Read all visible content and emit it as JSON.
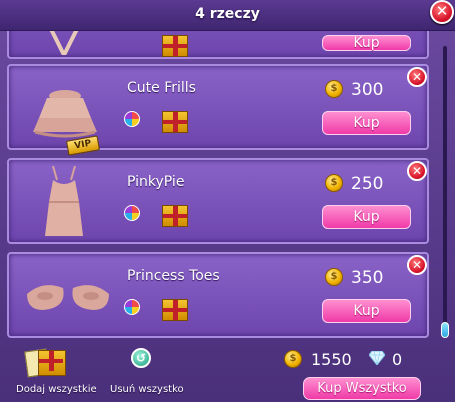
{
  "window": {
    "title": "4 rzeczy"
  },
  "items": [
    {
      "name": "Cute Frills",
      "price": "300",
      "buy_label": "Kup",
      "vip": "VIP"
    },
    {
      "name": "PinkyPie",
      "price": "250",
      "buy_label": "Kup"
    },
    {
      "name": "Princess Toes",
      "price": "350",
      "buy_label": "Kup"
    }
  ],
  "partial_top_item": {
    "buy_label": "Kup"
  },
  "footer": {
    "add_all_label": "Dodaj wszystkie",
    "remove_all_label": "Usuń wszystko",
    "coins": "1550",
    "diamonds": "0",
    "buy_all_label": "Kup Wszystko"
  },
  "icons": {
    "close": "close-icon",
    "remove": "remove-icon",
    "coin": "coin-icon",
    "diamond": "diamond-icon",
    "gift": "gift-icon",
    "ball": "rainbow-ball-icon",
    "undo": "undo-icon"
  },
  "colors": {
    "accent_pink": "#f03aa8",
    "panel_purple": "#6d45ad",
    "close_red": "#d8122a"
  }
}
